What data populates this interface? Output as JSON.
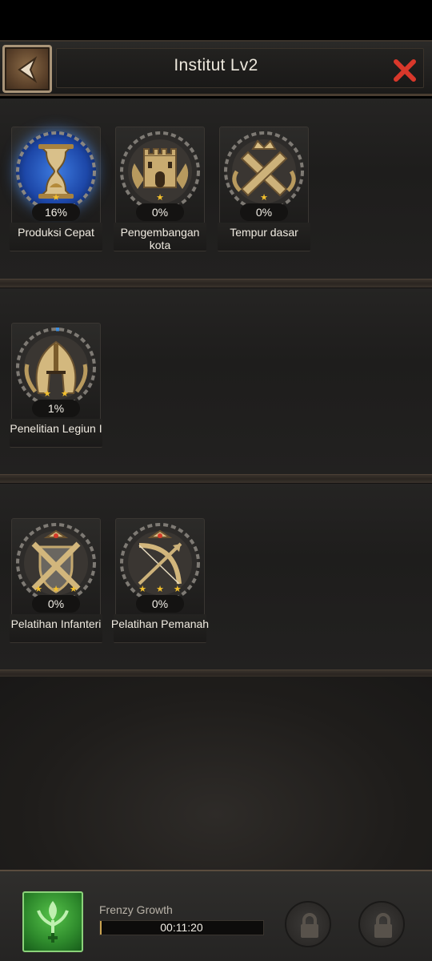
{
  "header": {
    "title": "Institut Lv2"
  },
  "sections": [
    {
      "nodes": [
        {
          "label": "Produksi Cepat",
          "percent": "16%",
          "stars": 1,
          "progress": 0.16,
          "icon": "hourglass-icon",
          "active": true
        },
        {
          "label": "Pengembangan kota",
          "percent": "0%",
          "stars": 1,
          "progress": 0,
          "icon": "castle-icon",
          "active": false
        },
        {
          "label": "Tempur dasar",
          "percent": "0%",
          "stars": 1,
          "progress": 0,
          "icon": "crossed-swords-icon",
          "active": false
        }
      ]
    },
    {
      "nodes": [
        {
          "label": "Penelitian Legiun I",
          "percent": "1%",
          "stars": 2,
          "progress": 0.01,
          "icon": "helmet-icon",
          "active": false
        }
      ]
    },
    {
      "nodes": [
        {
          "label": "Pelatihan Infanteri",
          "percent": "0%",
          "stars": 3,
          "progress": 0,
          "icon": "infantry-shield-icon",
          "active": false
        },
        {
          "label": "Pelatihan Pemanah",
          "percent": "0%",
          "stars": 3,
          "progress": 0,
          "icon": "bow-icon",
          "active": false
        }
      ]
    }
  ],
  "boost": {
    "name": "Frenzy Growth",
    "timer": "00:11:20",
    "progress": 0.01,
    "icon": "wheat-growth-icon"
  },
  "colors": {
    "accent_gold": "#c9a250",
    "close_red": "#d9382b",
    "active_blue": "#3d7be0",
    "star_yellow": "#f3c02d"
  }
}
